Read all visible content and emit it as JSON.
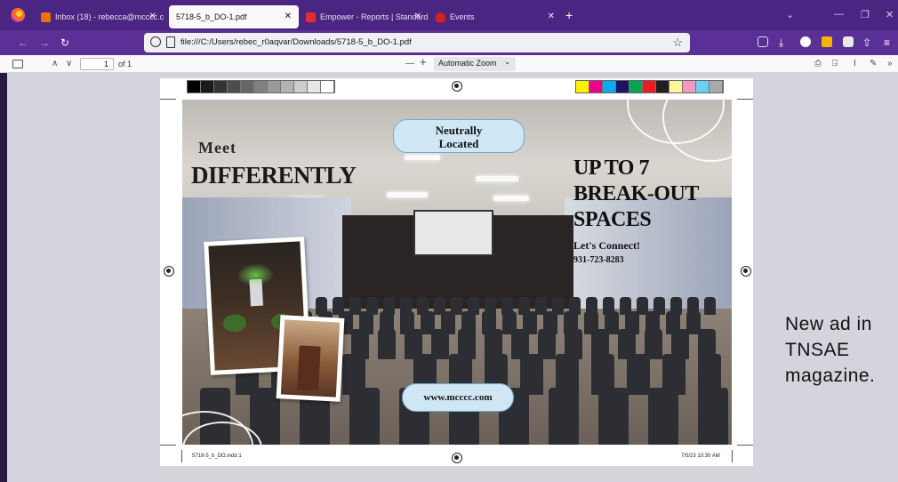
{
  "tabs": [
    {
      "label": "Inbox (18) - rebecca@mcccc.c",
      "active": false
    },
    {
      "label": "5718-5_b_DO-1.pdf",
      "active": true
    },
    {
      "label": "Empower - Reports | Standard",
      "active": false
    },
    {
      "label": "Events",
      "active": false
    }
  ],
  "address_bar": {
    "url": "file:///C:/Users/rebec_r0aqvar/Downloads/5718-5_b_DO-1.pdf"
  },
  "pdf_toolbar": {
    "page_number": "1",
    "page_count": "of 1",
    "zoom": "Automatic Zoom"
  },
  "ad": {
    "bubble_top_line1": "Neutrally",
    "bubble_top_line2": "Located",
    "meet": "Meet",
    "differently": "DIFFERENTLY",
    "headline_line1": "UP TO 7",
    "headline_line2": "BREAK-OUT",
    "headline_line3": "SPACES",
    "connect": "Let's Connect!",
    "phone": "931-723-8283",
    "website": "www.mcccc.com"
  },
  "page_footer": {
    "filename": "5718-5_b_DO.indd   1",
    "datetime": "7/5/23   10:30 AM"
  },
  "side_note": "New ad in TNSAE magazine.",
  "colors": {
    "tabbar": "#4b2582",
    "navbar": "#5a2f96",
    "grayscale_strip": [
      "#000000",
      "#1a1a1a",
      "#333333",
      "#4d4d4d",
      "#666666",
      "#808080",
      "#999999",
      "#b3b3b3",
      "#cccccc",
      "#e6e6e6",
      "#ffffff"
    ],
    "color_strip": [
      "#fff200",
      "#ec008c",
      "#00aeef",
      "#1b1464",
      "#00a651",
      "#ed1c24",
      "#231f20",
      "#fff799",
      "#f49ac1",
      "#6dcff6",
      "#a7a9ac"
    ]
  },
  "icons": [
    "firefox-logo-icon",
    "close-icon",
    "plus-icon",
    "back-icon",
    "forward-icon",
    "reload-icon",
    "star-icon",
    "sidebar-toggle-icon",
    "print-icon",
    "save-icon",
    "text-cursor-icon",
    "draw-icon",
    "registration-mark-icon"
  ]
}
